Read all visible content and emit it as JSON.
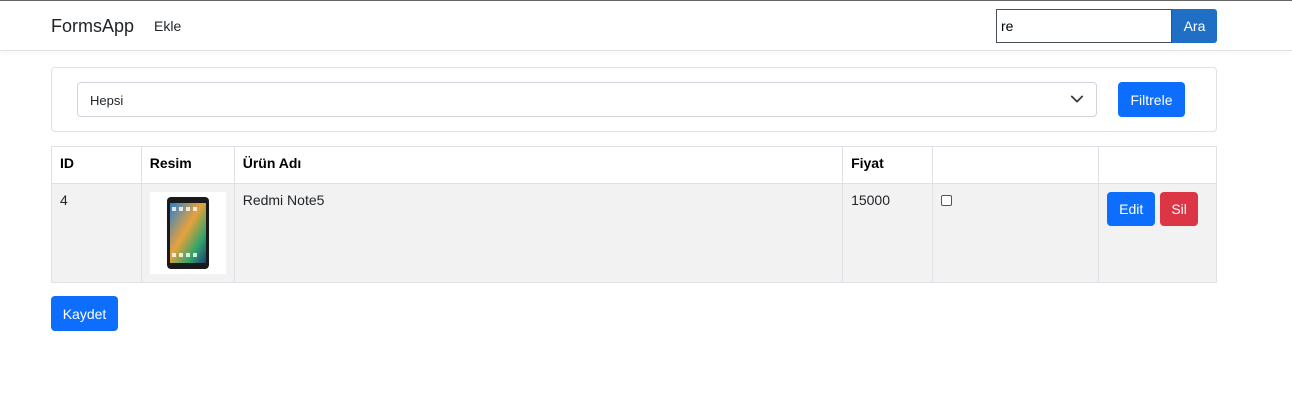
{
  "navbar": {
    "brand": "FormsApp",
    "links": [
      "Ekle"
    ],
    "search": {
      "value": "re",
      "button_label": "Ara"
    }
  },
  "filter": {
    "selected": "Hepsi",
    "button_label": "Filtrele"
  },
  "table": {
    "headers": [
      "ID",
      "Resim",
      "Ürün Adı",
      "Fiyat",
      "",
      ""
    ],
    "rows": [
      {
        "id": "4",
        "image_icon": "smartphone-image",
        "name": "Redmi Note5",
        "price": "15000",
        "checked": false,
        "edit_label": "Edit",
        "delete_label": "Sil"
      }
    ]
  },
  "save_label": "Kaydet",
  "colors": {
    "primary": "#0d6efd",
    "danger": "#dc3545",
    "search_button": "#1f6fc5"
  }
}
